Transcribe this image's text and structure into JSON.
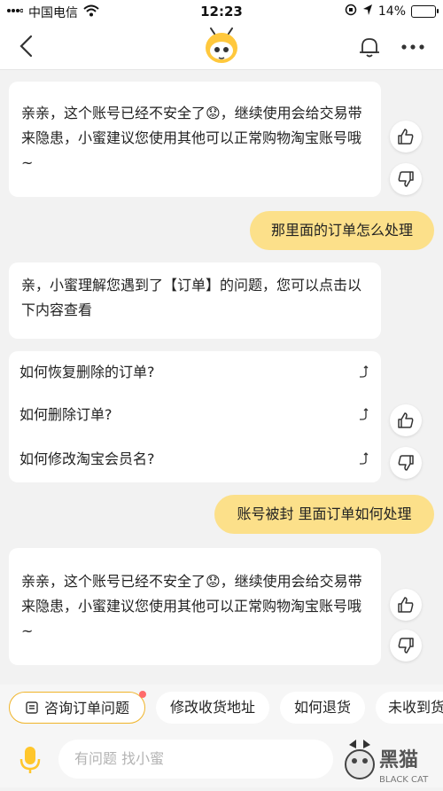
{
  "status_bar": {
    "carrier": "中国电信",
    "time": "12:23",
    "battery": "14%"
  },
  "nav": {
    "back_icon": "chevron-left-icon",
    "avatar_icon": "bee-mascot-icon",
    "bell_icon": "bell-icon",
    "more_icon": "more-dots-icon"
  },
  "messages": [
    {
      "side": "left",
      "text": "亲亲，这个账号已经不安全了😟，继续使用会给交易带来隐患，小蜜建议您使用其他可以正常购物淘宝账号哦~"
    },
    {
      "side": "right",
      "text": "那里面的订单怎么处理"
    },
    {
      "side": "left",
      "text": "亲，小蜜理解您遇到了【订单】的问题，您可以点击以下内容查看"
    },
    {
      "side": "right",
      "text": "账号被封 里面订单如何处理"
    },
    {
      "side": "left",
      "text": "亲亲，这个账号已经不安全了😟，继续使用会给交易带来隐患，小蜜建议您使用其他可以正常购物淘宝账号哦~"
    }
  ],
  "questions": [
    {
      "label": "如何恢复删除的订单?"
    },
    {
      "label": "如何删除订单?"
    },
    {
      "label": "如何修改淘宝会员名?"
    }
  ],
  "chips": [
    {
      "label": "咨询订单问题",
      "icon": "order-icon",
      "active": true
    },
    {
      "label": "修改收货地址"
    },
    {
      "label": "如何退货"
    },
    {
      "label": "未收到货"
    }
  ],
  "input": {
    "placeholder": "有问题 找小蜜"
  },
  "watermark": {
    "text": "黑猫",
    "subtext": "BLACK CAT"
  }
}
